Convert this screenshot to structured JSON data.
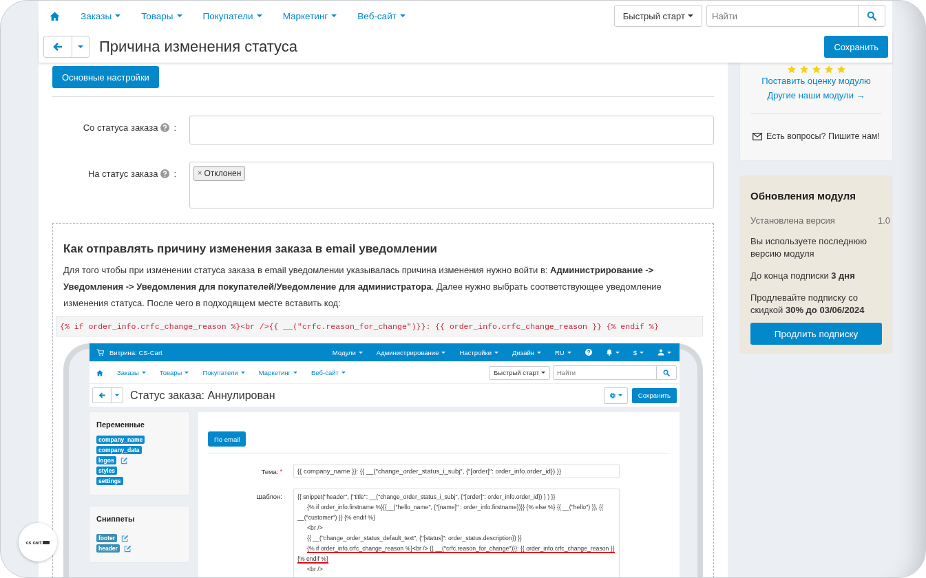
{
  "nav": {
    "items": [
      {
        "label": "Заказы"
      },
      {
        "label": "Товары"
      },
      {
        "label": "Покупатели"
      },
      {
        "label": "Маркетинг"
      },
      {
        "label": "Веб-сайт"
      }
    ],
    "quick_start": "Быстрый старт",
    "search": {
      "placeholder": "Найти"
    }
  },
  "title_bar": {
    "title": "Причина изменения статуса",
    "save": "Сохранить"
  },
  "tabs": [
    {
      "label": "Основные настройки",
      "selected": true
    }
  ],
  "fields": [
    {
      "kind": "input",
      "label": "Со статуса заказа",
      "colon": ":"
    },
    {
      "kind": "tags",
      "label": "На статус заказа",
      "colon": ":",
      "tags": [
        {
          "label": "Отклонен",
          "remove": "×"
        }
      ]
    }
  ],
  "help": {
    "heading": "Как отправлять причину изменения заказа в email уведомлении",
    "paragraph": "Для того чтобы при изменении статуса заказа в email уведомлении указывалась причина изменения нужно войти в: **Администрирование -> Уведомления -> Уведомления для покупателей/Уведомление для администратора**. Далее нужно выбрать соответствующее уведомление изменения статуса. После чего в подходящем месте вставить код:",
    "code": "{% if order_info.crfc_change_reason %}<br />{{ __(\"crfc.reason_for_change\")}}: {{ order_info.crfc_change_reason }} {% endif %}"
  },
  "embedded": {
    "topbar": {
      "store": "Витрина: CS-Cart",
      "menus": [
        {
          "kind": "menu",
          "label": "Модули"
        },
        {
          "kind": "menu",
          "label": "Администрирование"
        },
        {
          "kind": "menu",
          "label": "Настройки"
        },
        {
          "kind": "menu",
          "label": "Дизайн"
        },
        {
          "kind": "menu",
          "label": "RU"
        },
        {
          "kind": "help"
        },
        {
          "kind": "bell"
        },
        {
          "kind": "menu",
          "label": "$"
        },
        {
          "kind": "user"
        }
      ]
    },
    "nav": {
      "items": [
        {
          "label": "Заказы"
        },
        {
          "label": "Товары"
        },
        {
          "label": "Покупатели"
        },
        {
          "label": "Маркетинг"
        },
        {
          "label": "Веб-сайт"
        }
      ],
      "quick_start": "Быстрый старт",
      "search": {
        "placeholder": "Найти"
      }
    },
    "title": "Статус заказа: Аннулирован",
    "save": "Сохранить",
    "panels": [
      {
        "title": "Переменные",
        "kind": "variables",
        "items": [
          {
            "label": "company_name",
            "editable": false
          },
          {
            "label": "company_data",
            "editable": false
          },
          {
            "label": "logos",
            "editable": true
          },
          {
            "label": "styles",
            "editable": false
          },
          {
            "label": "settings",
            "editable": false
          }
        ]
      },
      {
        "title": "Сниппеты",
        "kind": "snippets",
        "items": [
          {
            "label": "footer",
            "editable": true
          },
          {
            "label": "header",
            "editable": true
          }
        ]
      }
    ],
    "tab": {
      "label": "По email",
      "selected": true
    },
    "subject": {
      "label": "Тема:",
      "required_mark": "*",
      "value": "{{ company_name }}: {{ __(\"change_order_status_i_subj\", {\"[order]\": order_info.order_id}) }}"
    },
    "template": {
      "label": "Шаблон:",
      "lines": [
        {
          "text": "{{ snippet(\"header\", {\"title\": __(\"change_order_status_i_subj\", {\"[order]\": order_info.order_id}) } ) }}",
          "indented": false,
          "underlined": false
        },
        {
          "text": "{% if order_info.firstname %}{{__(\"hello_name\", {\"[name]\" : order_info.firstname})}} {% else %} {{ __(\"hello\") }},  {{",
          "indented": true,
          "underlined": false
        },
        {
          "text": "__(\"customer\") }} {% endif %}",
          "indented": false,
          "underlined": false
        },
        {
          "text": "<br />",
          "indented": true,
          "underlined": false
        },
        {
          "text": "{{ __(\"change_order_status_default_text\", {\"[status]\": order_status.description}) }}",
          "indented": true,
          "underlined": false
        },
        {
          "text": "{% if order_info.crfc_change_reason %}<br /> {{ __(\"crfc.reason_for_change\")}}: {{ order_info.crfc_change_reason }}",
          "indented": true,
          "underlined": true
        },
        {
          "text": "{% endif %}",
          "indented": false,
          "underlined": true
        },
        {
          "text": "<br />",
          "indented": true,
          "underlined": false
        }
      ]
    }
  },
  "sidebar": {
    "rating": {
      "stars": 5,
      "rate_link": "Поставить оценку модулю",
      "more_link": "Другие наши модули →",
      "contact": "Есть вопросы? Пишите нам!"
    },
    "updates": {
      "title": "Обновления модуля",
      "version_label": "Установлена версия",
      "version": "1.0",
      "texts": [
        "Вы используете последнюю версию модуля",
        "До конца подписки **3 дня**",
        "Продлевайте подписку со скидкой **30% до 03/06/2024**"
      ],
      "button": "Продлить подписку"
    }
  },
  "badge": {
    "text": "cs cart"
  }
}
